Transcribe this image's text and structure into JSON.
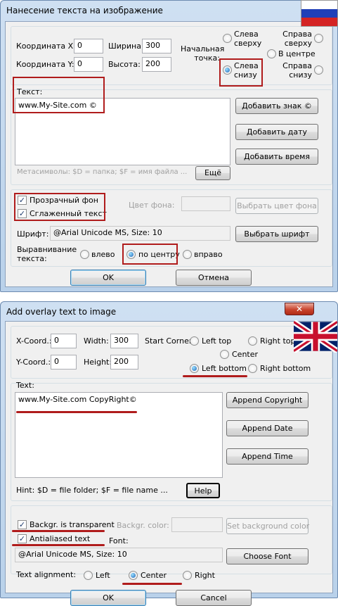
{
  "ru": {
    "title": "Нанесение текста на изображение",
    "close": "✕",
    "coord_x_label": "Координата X:",
    "coord_x_value": "0",
    "coord_y_label": "Координата Y:",
    "coord_y_value": "0",
    "width_label": "Ширина:",
    "width_value": "300",
    "height_label": "Высота:",
    "height_value": "200",
    "start_point_label": "Начальная точка:",
    "corner_left_top": "Слева сверху",
    "corner_right_top": "Справа сверху",
    "corner_center": "В центре",
    "corner_left_bottom": "Слева снизу",
    "corner_right_bottom": "Справа снизу",
    "text_label": "Текст:",
    "text_value": "www.My-Site.com ©",
    "add_sign": "Добавить знак",
    "add_date": "Добавить дату",
    "add_time": "Добавить время",
    "hint": "Метасимволы: $D = папка; $F = имя файла ...",
    "more": "Ещё",
    "transparent_bg": "Прозрачный фон",
    "smooth_text": "Сглаженный текст",
    "bg_color_label": "Цвет фона:",
    "choose_bg_color": "Выбрать цвет фона",
    "font_label": "Шрифт:",
    "font_value": "@Arial Unicode MS, Size: 10",
    "choose_font": "Выбрать шрифт",
    "align_label": "Выравнивание текста:",
    "align_left": "влево",
    "align_center": "по центру",
    "align_right": "вправо",
    "ok": "OK",
    "cancel": "Отмена"
  },
  "en": {
    "title": "Add overlay text to image",
    "close": "✕",
    "coord_x_label": "X-Coord.:",
    "coord_x_value": "0",
    "coord_y_label": "Y-Coord.:",
    "coord_y_value": "0",
    "width_label": "Width:",
    "width_value": "300",
    "height_label": "Height:",
    "height_value": "200",
    "start_corner_label": "Start Corner:",
    "corner_left_top": "Left top",
    "corner_right_top": "Right top",
    "corner_center": "Center",
    "corner_left_bottom": "Left bottom",
    "corner_right_bottom": "Right bottom",
    "text_label": "Text:",
    "text_value": "www.My-Site.com CopyRight©",
    "append_copyright": "Append Copyright",
    "append_date": "Append Date",
    "append_time": "Append Time",
    "hint": "Hint: $D = file folder; $F = file name ...",
    "help": "Help",
    "transparent_bg": "Backgr. is transparent",
    "antialiased": "Antialiased text",
    "bg_color_label": "Backgr. color:",
    "set_bg_color": "Set background color",
    "font_label": "Font:",
    "font_value": "@Arial Unicode MS, Size: 10",
    "choose_font": "Choose Font",
    "align_label": "Text alignment:",
    "align_left": "Left",
    "align_center": "Center",
    "align_right": "Right",
    "ok": "OK",
    "cancel": "Cancel"
  },
  "icons": {
    "ru_flag": "russia-flag-icon",
    "uk_flag": "uk-flag-icon",
    "copyright": "copyright-icon"
  },
  "colors": {
    "highlight_red": "#b01c1c",
    "title_glass": "#c4d9ef",
    "close_red": "#c9452f"
  }
}
